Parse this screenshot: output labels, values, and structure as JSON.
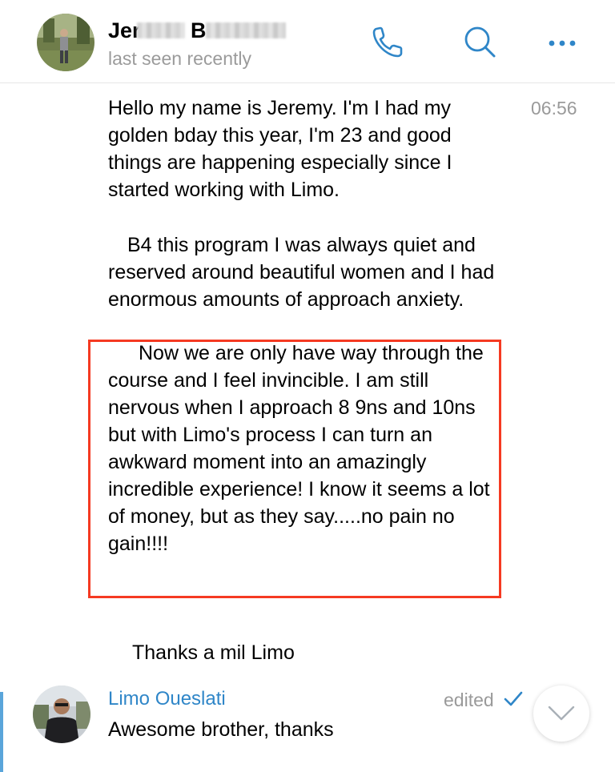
{
  "header": {
    "contact_name": "Jer",
    "contact_name_initial": "B",
    "status": "last seen recently",
    "icons": [
      "phone-icon",
      "search-icon",
      "more-icon"
    ]
  },
  "message": {
    "time": "06:56",
    "paragraphs": [
      "Hello my name is Jeremy. I'm I had my golden bday this year, I'm 23 and good things are happening especially since I started working with Limo.",
      "B4 this program I was always quiet and reserved around beautiful women and I had enormous amounts of approach anxiety.",
      "Now we are only have way through the course and I feel invincible. I am still nervous when I approach 8 9ns and 10ns but with Limo's process I can turn an awkward moment into an amazingly incredible experience! I know it seems a lot of money, but as they say.....no pain no gain!!!!",
      "Thanks a mil Limo"
    ]
  },
  "reply": {
    "author": "Limo Oueslati",
    "edited_label": "edited",
    "text": "Awesome brother, thanks"
  },
  "colors": {
    "accent": "#2f86c8",
    "highlight_border": "#f53a22",
    "meta_text": "#9a9a9a"
  }
}
